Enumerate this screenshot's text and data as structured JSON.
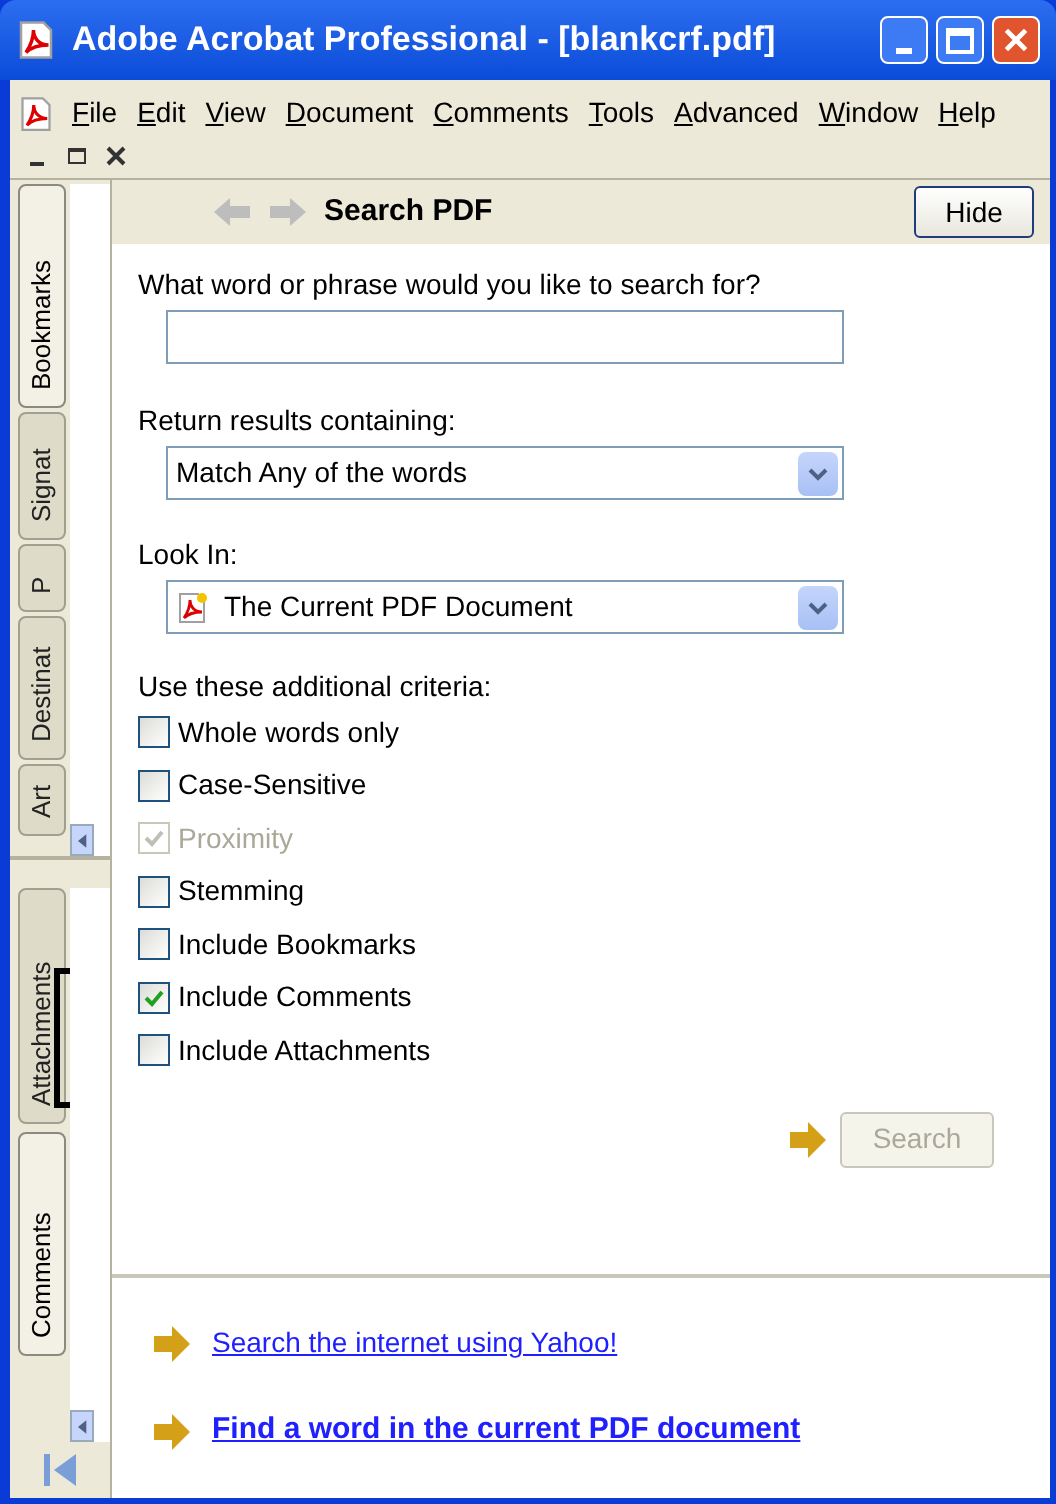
{
  "window": {
    "title": "Adobe Acrobat Professional - [blankcrf.pdf]"
  },
  "menu": [
    "File",
    "Edit",
    "View",
    "Document",
    "Comments",
    "Tools",
    "Advanced",
    "Window",
    "Help"
  ],
  "side_tabs_top": [
    {
      "label": "Bookmarks",
      "selected": true
    },
    {
      "label": "Signat",
      "selected": false
    },
    {
      "label": "P",
      "selected": false
    },
    {
      "label": "Destinat",
      "selected": false
    },
    {
      "label": "Art",
      "selected": false
    }
  ],
  "side_tabs_bottom": [
    {
      "label": "Attachments",
      "selected": false
    },
    {
      "label": "Comments",
      "selected": true
    }
  ],
  "panel": {
    "title": "Search PDF",
    "hide_button": "Hide",
    "query": {
      "label": "What word or phrase would you like to search for?"
    },
    "results": {
      "label": "Return results containing:",
      "value": "Match Any of the words"
    },
    "look_in": {
      "label": "Look In:",
      "value": "The Current PDF Document"
    },
    "criteria_label": "Use these additional criteria:",
    "criteria": [
      {
        "label": "Whole words only",
        "checked": false,
        "disabled": false
      },
      {
        "label": "Case-Sensitive",
        "checked": false,
        "disabled": false
      },
      {
        "label": "Proximity",
        "checked": true,
        "disabled": true
      },
      {
        "label": "Stemming",
        "checked": false,
        "disabled": false
      },
      {
        "label": "Include Bookmarks",
        "checked": false,
        "disabled": false
      },
      {
        "label": "Include Comments",
        "checked": true,
        "disabled": false
      },
      {
        "label": "Include Attachments",
        "checked": false,
        "disabled": false
      }
    ],
    "search_button": {
      "label": "Search",
      "disabled": true
    },
    "links": [
      {
        "label": "Search the internet using Yahoo!",
        "bold": false
      },
      {
        "label": "Find a word in the current PDF document",
        "bold": true
      }
    ]
  }
}
